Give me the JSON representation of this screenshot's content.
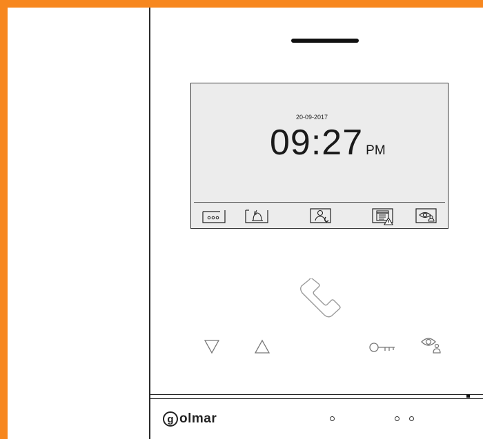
{
  "screen": {
    "date": "20-09-2017",
    "time": "09:27",
    "ampm": "PM"
  },
  "screen_icons": [
    "menu-icon",
    "ring-tone-icon",
    "intercom-icon",
    "agenda-alarm-icon",
    "monitor-icon"
  ],
  "buttons": [
    "phone-icon",
    "down-arrow-icon",
    "up-arrow-icon",
    "key-icon",
    "eye-user-icon"
  ],
  "brand": {
    "logo_letter": "g",
    "logo_text": "olmar"
  },
  "colors": {
    "frame": "#f7871f",
    "screen": "#ececec",
    "ink": "#222222"
  }
}
